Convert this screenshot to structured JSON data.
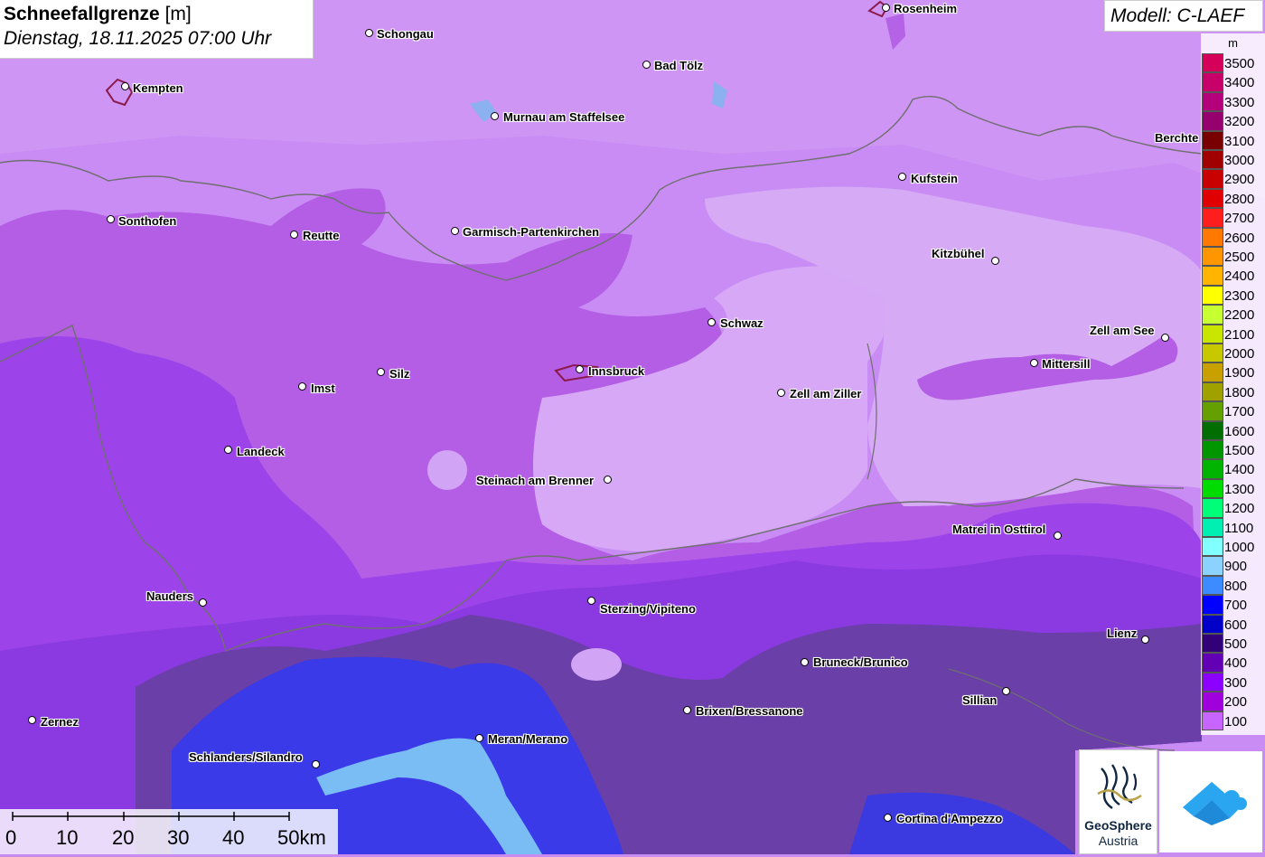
{
  "header": {
    "title": "Schneefallgrenze",
    "unit": "[m]",
    "datetime": "Dienstag, 18.11.2025 07:00 Uhr"
  },
  "model": {
    "label": "Modell: C-LAEF"
  },
  "legend": {
    "unit": "m",
    "entries": [
      {
        "label": "3500",
        "color": "#d4005a"
      },
      {
        "label": "3400",
        "color": "#c8006a"
      },
      {
        "label": "3300",
        "color": "#b4007a"
      },
      {
        "label": "3200",
        "color": "#96006e"
      },
      {
        "label": "3100",
        "color": "#780000"
      },
      {
        "label": "3000",
        "color": "#a00000"
      },
      {
        "label": "2900",
        "color": "#c80000"
      },
      {
        "label": "2800",
        "color": "#e00000"
      },
      {
        "label": "2700",
        "color": "#ff1e1e"
      },
      {
        "label": "2600",
        "color": "#ff7800"
      },
      {
        "label": "2500",
        "color": "#ff9600"
      },
      {
        "label": "2400",
        "color": "#ffb400"
      },
      {
        "label": "2300",
        "color": "#ffff00"
      },
      {
        "label": "2200",
        "color": "#c8ff32"
      },
      {
        "label": "2100",
        "color": "#c8e600"
      },
      {
        "label": "2000",
        "color": "#c8c800"
      },
      {
        "label": "1900",
        "color": "#c8a000"
      },
      {
        "label": "1800",
        "color": "#a0a000"
      },
      {
        "label": "1700",
        "color": "#64a000"
      },
      {
        "label": "1600",
        "color": "#006e00"
      },
      {
        "label": "1500",
        "color": "#009600"
      },
      {
        "label": "1400",
        "color": "#00b400"
      },
      {
        "label": "1300",
        "color": "#00dc00"
      },
      {
        "label": "1200",
        "color": "#00ff78"
      },
      {
        "label": "1100",
        "color": "#00f0b4"
      },
      {
        "label": "1000",
        "color": "#82ffff"
      },
      {
        "label": "900",
        "color": "#8cd2ff"
      },
      {
        "label": "800",
        "color": "#3c8cff"
      },
      {
        "label": "700",
        "color": "#0000ff"
      },
      {
        "label": "600",
        "color": "#0000c8"
      },
      {
        "label": "500",
        "color": "#320078"
      },
      {
        "label": "400",
        "color": "#6400b4"
      },
      {
        "label": "300",
        "color": "#8c00ff"
      },
      {
        "label": "200",
        "color": "#a000dc"
      },
      {
        "label": "100",
        "color": "#c864ff"
      }
    ]
  },
  "scale": {
    "ticks": [
      "0",
      "10",
      "20",
      "30",
      "40",
      "50km"
    ]
  },
  "cities": [
    "Rosenheim",
    "Schongau",
    "Kempten",
    "Bad Tölz",
    "Murnau am Staffelsee",
    "Berchtesgaden",
    "Kufstein",
    "Sonthofen",
    "Reutte",
    "Garmisch-Partenkirchen",
    "Kitzbühel",
    "Schwaz",
    "Zell am See",
    "Mittersill",
    "Innsbruck",
    "Silz",
    "Imst",
    "Zell am Ziller",
    "Landeck",
    "Steinach am Brenner",
    "Matrei in Osttirol",
    "Nauders",
    "Sterzing/Vipiteno",
    "Lienz",
    "Bruneck/Brunico",
    "Sillian",
    "Brixen/Bressanone",
    "Zernez",
    "Meran/Merano",
    "Schlanders/Silandro",
    "Cortina d'Ampezzo"
  ],
  "berchtesgaden_visible": "Berchte",
  "logos": {
    "geosphere_line1": "GeoSphere",
    "geosphere_line2": "Austria"
  },
  "colors": {
    "field_light": "#dab0f5",
    "field_mid": "#c27ef0",
    "field_purple": "#a94ee0",
    "field_violet": "#8a3ae8",
    "field_dark": "#6b3aa8",
    "field_blue": "#3a3ae0",
    "field_cyan": "#7ab8f0"
  }
}
